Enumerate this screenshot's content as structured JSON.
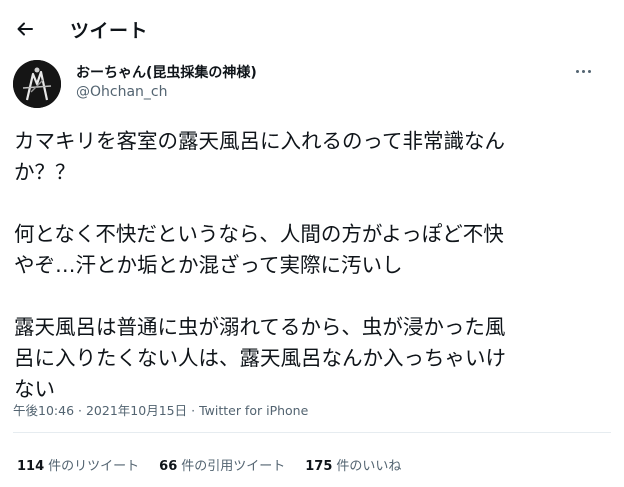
{
  "header": {
    "back_icon": "arrow-left-icon",
    "title": "ツイート"
  },
  "tweet": {
    "author": {
      "display_name": "おーちゃん(昆虫採集の神様)",
      "handle": "@Ohchan_ch",
      "avatar_icon": "avatar-silhouette"
    },
    "more_icon": "more-dots-icon",
    "paragraphs": [
      [
        "カマキリを客室の露天風呂に入れるのって非常識なん",
        "か？？"
      ],
      [
        "何となく不快だというなら、人間の方がよっぽど不快",
        "やぞ…汗とか垢とか混ざって実際に汚いし"
      ],
      [
        "露天風呂は普通に虫が溺れてるから、虫が浸かった風",
        "呂に入りたくない人は、露天風呂なんか入っちゃいけ",
        "ない"
      ]
    ],
    "time": "午後10:46",
    "separator": "·",
    "date": "2021年10月15日",
    "source": "Twitter for iPhone"
  },
  "stats": {
    "retweets": {
      "count": "114",
      "label": "件のリツイート"
    },
    "quotes": {
      "count": "66",
      "label": "件の引用ツイート"
    },
    "likes": {
      "count": "175",
      "label": "件のいいね"
    }
  },
  "colors": {
    "text_primary": "#0f1419",
    "text_secondary": "#536471",
    "divider": "#e6ecf0",
    "background": "#ffffff"
  }
}
